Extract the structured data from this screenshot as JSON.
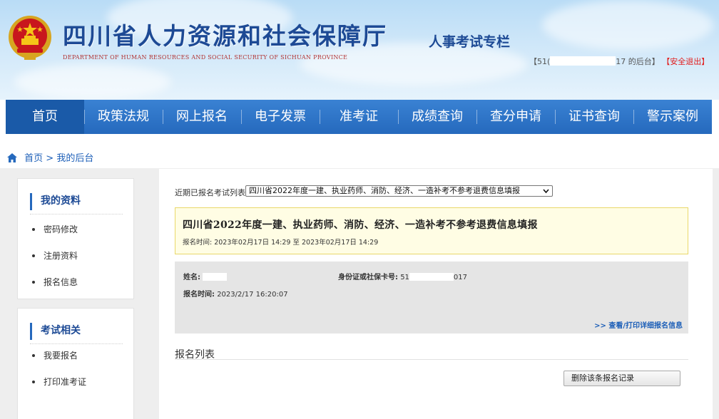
{
  "header": {
    "site_title": "四川省人力资源和社会保障厅",
    "site_subtitle": "DEPARTMENT OF HUMAN RESOURCES AND SOCIAL SECURITY OF SICHUAN PROVINCE",
    "column_title": "人事考试专栏",
    "user_id_prefix": "【51(",
    "user_id_suffix": "17 的后台】",
    "logout_label": "【安全退出】"
  },
  "nav": {
    "items": [
      "首页",
      "政策法规",
      "网上报名",
      "电子发票",
      "准考证",
      "成绩查询",
      "查分申请",
      "证书查询",
      "警示案例"
    ],
    "active_index": 0
  },
  "breadcrumb": {
    "home": "首页",
    "separator": ">",
    "current": "我的后台"
  },
  "sidebar": {
    "sections": [
      {
        "title": "我的资料",
        "links": [
          "密码修改",
          "注册资料",
          "报名信息"
        ]
      },
      {
        "title": "考试相关",
        "links": [
          "我要报名",
          "打印准考证"
        ]
      }
    ]
  },
  "main": {
    "select_label": "近期已报名考试列表:",
    "select_value": "四川省2022年度一建、执业药师、消防、经济、一造补考不参考退费信息填报",
    "notice": {
      "title": "四川省2022年度一建、执业药师、消防、经济、一造补考不参考退费信息填报",
      "time_text": "报名时间: 2023年02月17日 14:29 至 2023年02月17日 14:29"
    },
    "info": {
      "name_label": "姓名:",
      "id_label": "身份证或社保卡号:",
      "id_prefix": "51",
      "id_suffix": "017",
      "reg_time_label": "报名时间:",
      "reg_time_value": "2023/2/17 16:20:07",
      "detail_link": ">> 查看/打印详细报名信息"
    },
    "list_title": "报名列表",
    "delete_button": "删除该条报名记录"
  },
  "colors": {
    "nav_blue": "#2569bd",
    "title_blue": "#1d4a95",
    "logout_red": "#e21b1b",
    "notice_bg": "#fffde4"
  },
  "icons": [
    "national-emblem",
    "home-icon",
    "chevron-down-icon"
  ]
}
